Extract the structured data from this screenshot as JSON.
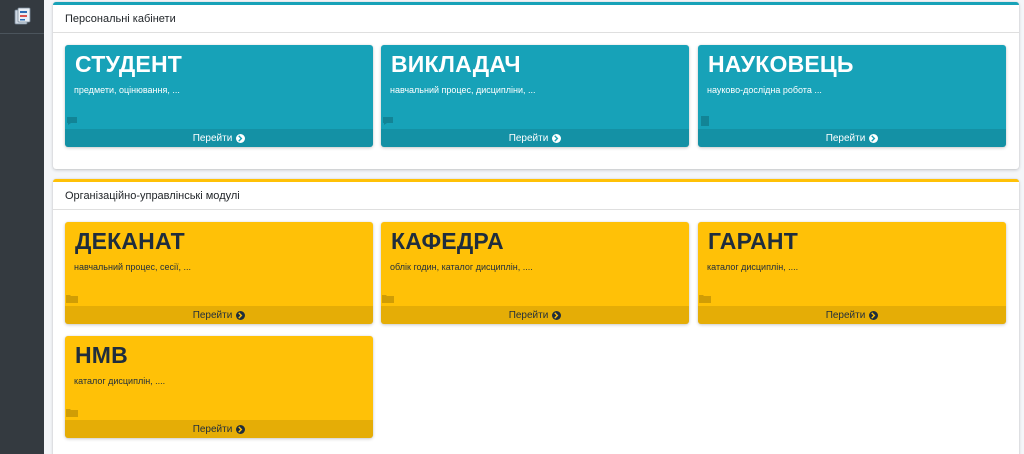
{
  "personal": {
    "header": "Персональні кабінети",
    "tiles": [
      {
        "title": "СТУДЕНТ",
        "desc": "предмети, оцінювання, ...",
        "link": "Перейти",
        "icon": "chat-icon"
      },
      {
        "title": "ВИКЛАДАЧ",
        "desc": "навчальний процес, дисципліни, ...",
        "link": "Перейти",
        "icon": "chat-icon"
      },
      {
        "title": "НАУКОВЕЦЬ",
        "desc": "науково-дослідна робота ...",
        "link": "Перейти",
        "icon": "book-icon"
      }
    ]
  },
  "modules": {
    "header": "Організаційно-управлінські модулі",
    "tiles": [
      {
        "title": "ДЕКАНАТ",
        "desc": "навчальний процес, сесії, ...",
        "link": "Перейти",
        "icon": "folder-icon"
      },
      {
        "title": "КАФЕДРА",
        "desc": "облік годин, каталог дисциплін, ....",
        "link": "Перейти",
        "icon": "folder-icon"
      },
      {
        "title": "ГАРАНТ",
        "desc": "каталог дисциплін, ....",
        "link": "Перейти",
        "icon": "folder-icon"
      },
      {
        "title": "НМВ",
        "desc": "каталог дисциплін, ....",
        "link": "Перейти",
        "icon": "folder-icon"
      }
    ]
  },
  "colors": {
    "info": "#17a2b8",
    "warning": "#ffc107",
    "sidebar": "#343a40"
  }
}
